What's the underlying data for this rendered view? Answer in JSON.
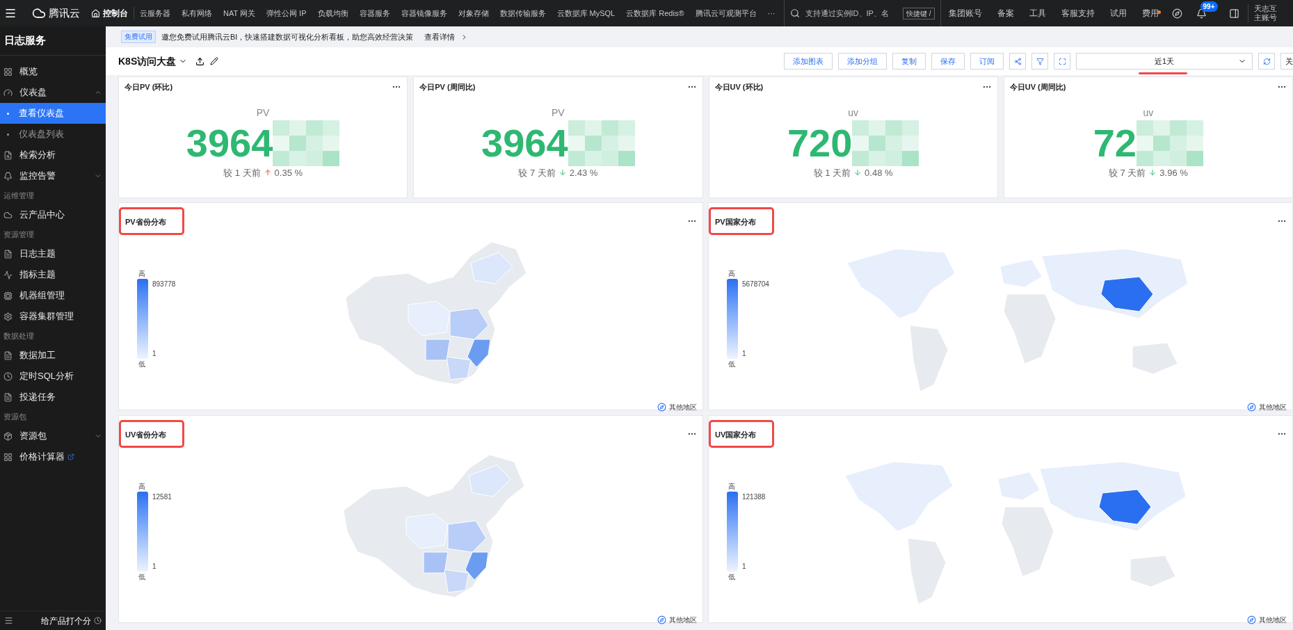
{
  "topbar": {
    "brand": "腾讯云",
    "home": "控制台",
    "nav": [
      "云服务器",
      "私有网络",
      "NAT 网关",
      "弹性公网 IP",
      "负载均衡",
      "容器服务",
      "容器镜像服务",
      "对象存储",
      "数据传输服务",
      "云数据库 MySQL",
      "云数据库 Redis®",
      "腾讯云可观测平台",
      "···"
    ],
    "search": {
      "placeholder": "支持通过实例ID、IP、名",
      "shortcut": "快捷键 /"
    },
    "links": [
      {
        "label": "集团账号",
        "dot": false
      },
      {
        "label": "备案",
        "dot": false
      },
      {
        "label": "工具",
        "dot": false
      },
      {
        "label": "客服支持",
        "dot": false
      },
      {
        "label": "试用",
        "dot": false
      },
      {
        "label": "费用",
        "dot": true
      }
    ],
    "badge": "99+",
    "user": "天志互",
    "account": "主账号"
  },
  "sidebar": {
    "title": "日志服务",
    "items": [
      {
        "kind": "item",
        "label": "概览"
      },
      {
        "kind": "item",
        "label": "仪表盘",
        "expanded": true
      },
      {
        "kind": "sub",
        "label": "查看仪表盘",
        "selected": true
      },
      {
        "kind": "sub",
        "label": "仪表盘列表",
        "selected": false
      },
      {
        "kind": "item",
        "label": "检索分析"
      },
      {
        "kind": "item",
        "label": "监控告警",
        "expanded": false
      },
      {
        "kind": "section",
        "label": "运维管理"
      },
      {
        "kind": "item",
        "label": "云产品中心"
      },
      {
        "kind": "section",
        "label": "资源管理"
      },
      {
        "kind": "item",
        "label": "日志主题"
      },
      {
        "kind": "item",
        "label": "指标主题"
      },
      {
        "kind": "item",
        "label": "机器组管理"
      },
      {
        "kind": "item",
        "label": "容器集群管理"
      },
      {
        "kind": "section",
        "label": "数据处理"
      },
      {
        "kind": "item",
        "label": "数据加工"
      },
      {
        "kind": "item",
        "label": "定时SQL分析"
      },
      {
        "kind": "item",
        "label": "投递任务"
      },
      {
        "kind": "section",
        "label": "资源包"
      },
      {
        "kind": "item",
        "label": "资源包",
        "expanded": false
      },
      {
        "kind": "item",
        "label": "价格计算器",
        "external": true
      }
    ],
    "feedback": "给产品打个分"
  },
  "banner": {
    "tag": "免费试用",
    "text": "邀您免费试用腾讯云BI，快速搭建数据可视化分析看板，助您高效经营决策",
    "link": "查看详情"
  },
  "toolbar": {
    "title": "K8S访问大盘",
    "buttons": [
      "添加图表",
      "添加分组",
      "复制",
      "保存",
      "订阅"
    ],
    "time_range": "近1天",
    "close": "关"
  },
  "kpis": [
    {
      "title": "今日PV (环比)",
      "unit": "PV",
      "value": "3964",
      "compare": "较 1 天前",
      "rising": true,
      "change": "0.35 %"
    },
    {
      "title": "今日PV (周同比)",
      "unit": "PV",
      "value": "3964",
      "compare": "较 7 天前",
      "rising": false,
      "change": "2.43 %"
    },
    {
      "title": "今日UV (环比)",
      "unit": "uv",
      "value": "720",
      "compare": "较 1 天前",
      "rising": false,
      "change": "0.48 %"
    },
    {
      "title": "今日UV (周同比)",
      "unit": "uv",
      "value": "72",
      "compare": "较 7 天前",
      "rising": false,
      "change": "3.96 %"
    }
  ],
  "maps": [
    {
      "title": "PV省份分布",
      "kind": "china",
      "high": "高",
      "max": "893778",
      "min": "1",
      "low": "低",
      "other": "其他地区"
    },
    {
      "title": "PV国家分布",
      "kind": "world",
      "high": "高",
      "max": "5678704",
      "min": "1",
      "low": "低",
      "other": "其他地区"
    },
    {
      "title": "UV省份分布",
      "kind": "china",
      "high": "高",
      "max": "12581",
      "min": "1",
      "low": "低",
      "other": "其他地区"
    },
    {
      "title": "UV国家分布",
      "kind": "world",
      "high": "高",
      "max": "121388",
      "min": "1",
      "low": "低",
      "other": "其他地区"
    }
  ]
}
